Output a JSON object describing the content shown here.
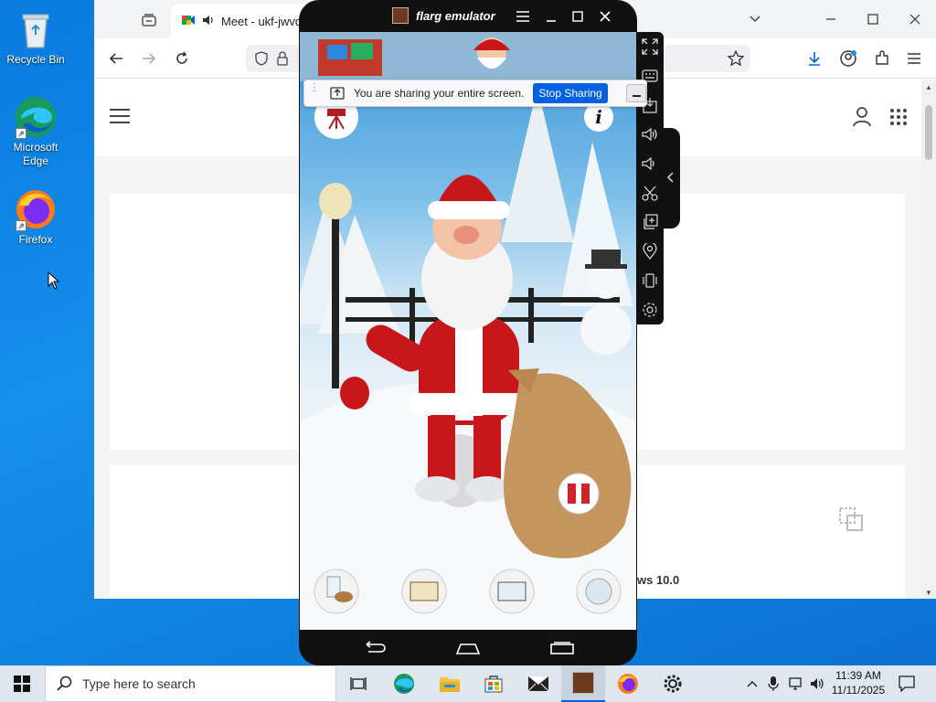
{
  "desktop": {
    "icons": [
      {
        "label": "Recycle Bin"
      },
      {
        "label": "Microsoft Edge"
      },
      {
        "label": "Firefox"
      }
    ]
  },
  "browser": {
    "tab_title": "Meet - ukf-jwvd-",
    "page_snippet": "ws 10.0"
  },
  "share_bar": {
    "message": "You are sharing your entire screen.",
    "stop_label": "Stop Sharing"
  },
  "emulator": {
    "title": "flarg emulator"
  },
  "taskbar": {
    "search_placeholder": "Type here to search",
    "time": "11:39 AM",
    "date": "11/11/2025"
  },
  "colors": {
    "desktop_blue": "#0a7ae0",
    "stop_button": "#0061e0",
    "santa_red": "#c8171b"
  }
}
